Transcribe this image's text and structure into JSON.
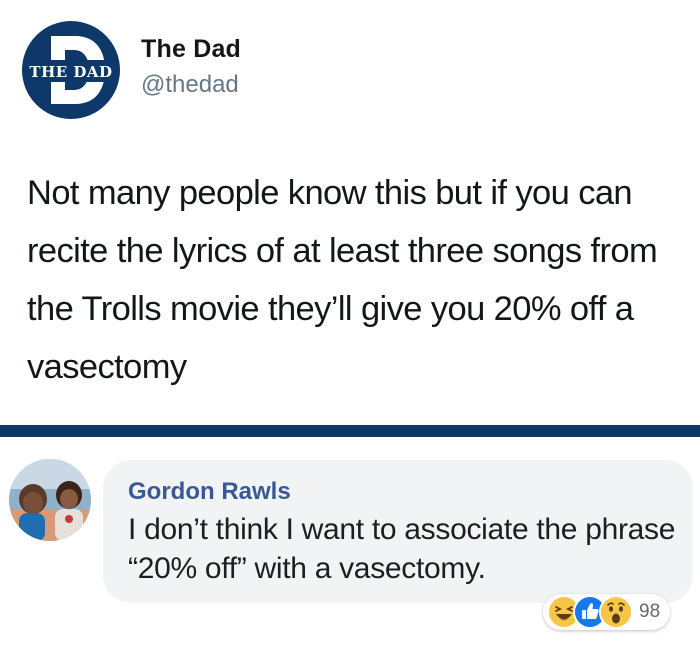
{
  "tweet": {
    "logo_text": "THE DAD",
    "author_name": "The Dad",
    "author_handle": "@thedad",
    "text": "Not many people know this but if you can recite the lyrics of at least three songs from the Trolls movie they’ll give you 20% off a vasectomy"
  },
  "comment": {
    "commenter_name": "Gordon Rawls",
    "text": "I don’t think I want to associate the phrase “20% off” with a vasectomy.",
    "reactions": {
      "icons": [
        "haha-icon",
        "like-icon",
        "wow-icon"
      ],
      "count": "98"
    }
  },
  "colors": {
    "divider": "#0d3869",
    "logo_circle": "#0d3869",
    "commenter_name": "#385898",
    "bubble_bg": "#f2f3f5",
    "like_blue": "#1877f2",
    "reaction_yellow": "#f7c548"
  }
}
